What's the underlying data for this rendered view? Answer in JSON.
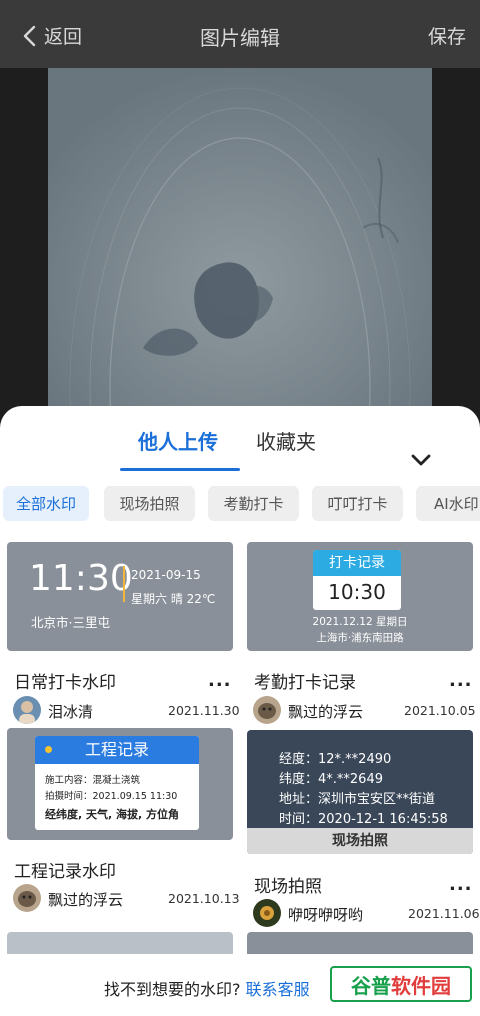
{
  "header": {
    "back_label": "返回",
    "title": "图片编辑",
    "save_label": "保存"
  },
  "tabs": {
    "active": "他人上传",
    "inactive": "收藏夹"
  },
  "categories": [
    "全部水印",
    "现场拍照",
    "考勤打卡",
    "叮叮打卡",
    "AI水印"
  ],
  "cards": [
    {
      "name": "日常打卡水印",
      "user": "泪冰清",
      "date": "2021.11.30",
      "preview": {
        "time": "11:30",
        "date": "2021-09-15",
        "weather": "星期六 晴 22℃",
        "location": "北京市·三里屯"
      }
    },
    {
      "name": "考勤打卡记录",
      "user": "飘过的浮云",
      "date": "2021.10.05",
      "preview": {
        "header": "打卡记录",
        "time": "10:30",
        "date": "2021.12.12 星期日",
        "address": "上海市·浦东南田路"
      }
    },
    {
      "name": "工程记录水印",
      "user": "飘过的浮云",
      "date": "2021.10.13",
      "preview": {
        "header": "工程记录",
        "line1": "施工内容：混凝土浇筑",
        "line2": "拍摄时间：2021.09.15 11:30",
        "line3": "经纬度, 天气, 海拔, 方位角"
      }
    },
    {
      "name": "现场拍照",
      "user": "咿呀咿呀哟",
      "date": "2021.11.06",
      "preview": {
        "line1": "经度：12*.**2490",
        "line2": "纬度：4*.**2649",
        "line3": "地址：深圳市宝安区**街道",
        "line4": "时间：2020-12-1  16:45:58",
        "footer": "现场拍照"
      }
    }
  ],
  "footer": {
    "text": "找不到想要的水印?",
    "link": "联系客服"
  },
  "watermark": {
    "part1": "谷普",
    "part2": "软件园"
  },
  "colors": {
    "accent": "#1a6fd8",
    "watermark_green": "#18a04c"
  }
}
